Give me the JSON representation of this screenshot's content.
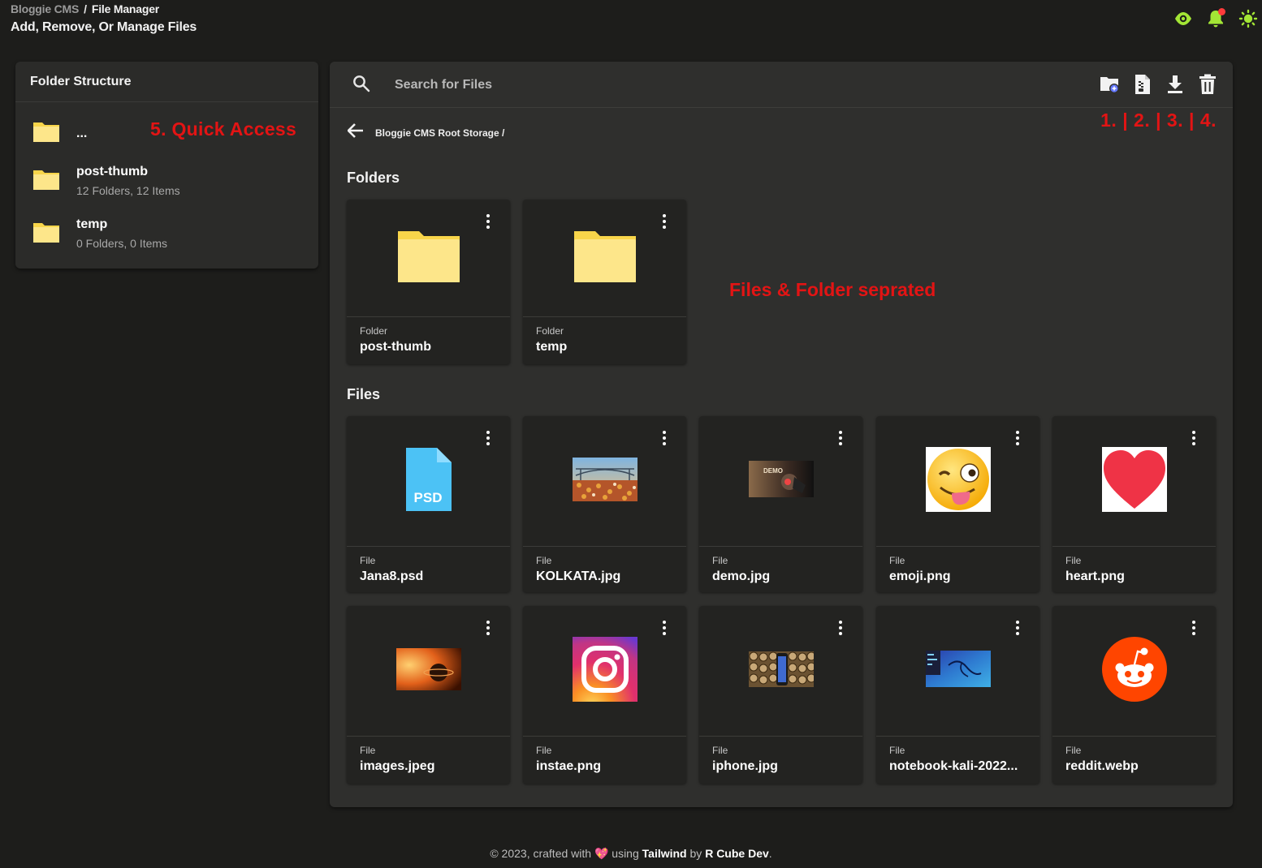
{
  "header": {
    "breadcrumb_root": "Bloggie CMS",
    "breadcrumb_sep": "/",
    "breadcrumb_current": "File Manager",
    "title": "Add, Remove, Or Manage Files",
    "icons": [
      "eye-icon",
      "bell-icon",
      "sun-icon"
    ],
    "accent_color": "#a3e635"
  },
  "sidebar": {
    "title": "Folder Structure",
    "annotation": "5. Quick Access",
    "items": [
      {
        "name": "...",
        "meta": ""
      },
      {
        "name": "post-thumb",
        "meta": "12 Folders, 12 Items"
      },
      {
        "name": "temp",
        "meta": "0 Folders, 0 Items"
      }
    ]
  },
  "main": {
    "search_placeholder": "Search for Files",
    "toolbar": [
      "new-folder-icon",
      "new-file-icon",
      "download-icon",
      "delete-icon"
    ],
    "toolbar_annotation": "1. | 2. | 3. | 4.",
    "path": "Bloggie CMS Root Storage /",
    "folders_title": "Folders",
    "files_title": "Files",
    "separation_annotation": "Files & Folder seprated",
    "folders": [
      {
        "kind": "Folder",
        "name": "post-thumb"
      },
      {
        "kind": "Folder",
        "name": "temp"
      }
    ],
    "files": [
      {
        "kind": "File",
        "name": "Jana8.psd",
        "thumb": "psd-icon",
        "thumb_text": "PSD"
      },
      {
        "kind": "File",
        "name": "KOLKATA.jpg",
        "thumb": "kolkata-image"
      },
      {
        "kind": "File",
        "name": "demo.jpg",
        "thumb": "demo-image",
        "thumb_text": "DEMO"
      },
      {
        "kind": "File",
        "name": "emoji.png",
        "thumb": "emoji-image"
      },
      {
        "kind": "File",
        "name": "heart.png",
        "thumb": "heart-image"
      },
      {
        "kind": "File",
        "name": "images.jpeg",
        "thumb": "planet-image"
      },
      {
        "kind": "File",
        "name": "instae.png",
        "thumb": "instagram-logo"
      },
      {
        "kind": "File",
        "name": "iphone.jpg",
        "thumb": "iphone-image"
      },
      {
        "kind": "File",
        "name": "notebook-kali-2022...",
        "thumb": "kali-image"
      },
      {
        "kind": "File",
        "name": "reddit.webp",
        "thumb": "reddit-logo"
      }
    ]
  },
  "footer": {
    "prefix": "© 2023, crafted with",
    "heart": "💖",
    "using": "using",
    "tailwind": "Tailwind",
    "by": "by",
    "author": "R Cube Dev",
    "suffix": "."
  }
}
